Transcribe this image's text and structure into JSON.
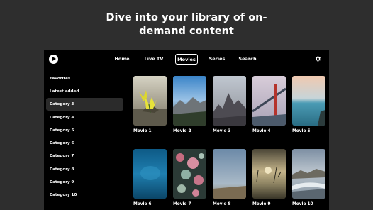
{
  "headline": {
    "line1": "Dive into your library of on-",
    "line2": "demand content"
  },
  "nav": {
    "logo_icon": "play-circle-icon",
    "tabs": [
      {
        "label": "Home",
        "active": false
      },
      {
        "label": "Live TV",
        "active": false
      },
      {
        "label": "Movies",
        "active": true
      },
      {
        "label": "Series",
        "active": false
      },
      {
        "label": "Search",
        "active": false
      }
    ],
    "settings_icon": "gear-icon"
  },
  "sidebar": {
    "items": [
      {
        "label": "Favorites",
        "active": false
      },
      {
        "label": "Latest added",
        "active": false
      },
      {
        "label": "Category 3",
        "active": true
      },
      {
        "label": "Category 4",
        "active": false
      },
      {
        "label": "Category 5",
        "active": false
      },
      {
        "label": "Category 6",
        "active": false
      },
      {
        "label": "Category 7",
        "active": false
      },
      {
        "label": "Category 8",
        "active": false
      },
      {
        "label": "Category 9",
        "active": false
      },
      {
        "label": "Category 10",
        "active": false
      }
    ]
  },
  "movies": [
    {
      "title": "Movie 1"
    },
    {
      "title": "Movie 2"
    },
    {
      "title": "Movie 3"
    },
    {
      "title": "Movie 4"
    },
    {
      "title": "Movie 5"
    },
    {
      "title": "Movie 6"
    },
    {
      "title": "Movie 7"
    },
    {
      "title": "Movie 8"
    },
    {
      "title": "Movie 9"
    },
    {
      "title": "Movie 10"
    }
  ],
  "colors": {
    "page_background": "#2e2e2e",
    "app_background": "#000000",
    "selected_category": "#2b2b2b",
    "text": "#ffffff"
  }
}
